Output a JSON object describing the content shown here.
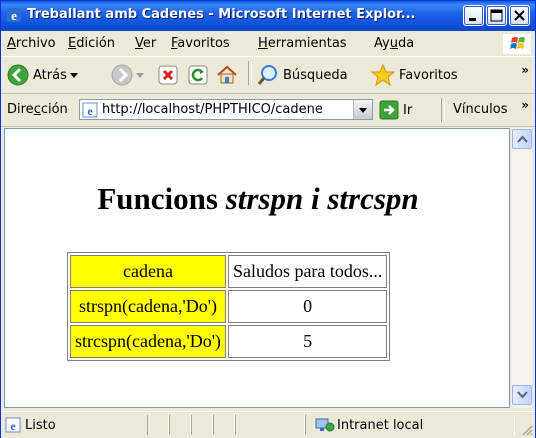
{
  "window": {
    "title": "Treballant amb Cadenes - Microsoft Internet Explor..."
  },
  "menu": {
    "items": [
      {
        "label_ul": "A",
        "label_rest": "rchivo"
      },
      {
        "label_ul": "E",
        "label_rest": "dición"
      },
      {
        "label_ul": "V",
        "label_rest": "er"
      },
      {
        "label_ul": "F",
        "label_rest": "avoritos"
      },
      {
        "label_ul": "H",
        "label_rest": "erramientas"
      },
      {
        "label_pre": "Ay",
        "label_ul": "u",
        "label_rest": "da"
      }
    ]
  },
  "toolbar": {
    "back_label": "Atrás",
    "search_label": "Búsqueda",
    "favorites_label": "Favoritos",
    "overflow": "»"
  },
  "address": {
    "label_pre": "Dire",
    "label_ul": "c",
    "label_rest": "ción",
    "url": "http://localhost/PHPTHICO/cadene",
    "go_label": "Ir",
    "links_label": "Vínculos",
    "overflow": "»"
  },
  "page": {
    "title_plain": "Funcions ",
    "title_italic": "strspn i strcspn",
    "table": [
      {
        "key": "cadena",
        "value": "Saludos para todos..."
      },
      {
        "key": "strspn(cadena,'Do')",
        "value": "0"
      },
      {
        "key": "strcspn(cadena,'Do')",
        "value": "5"
      }
    ]
  },
  "status": {
    "text": "Listo",
    "zone": "Intranet local"
  },
  "colors": {
    "titlebar": "#0a5ee0",
    "key_cell": "#ffff00"
  }
}
